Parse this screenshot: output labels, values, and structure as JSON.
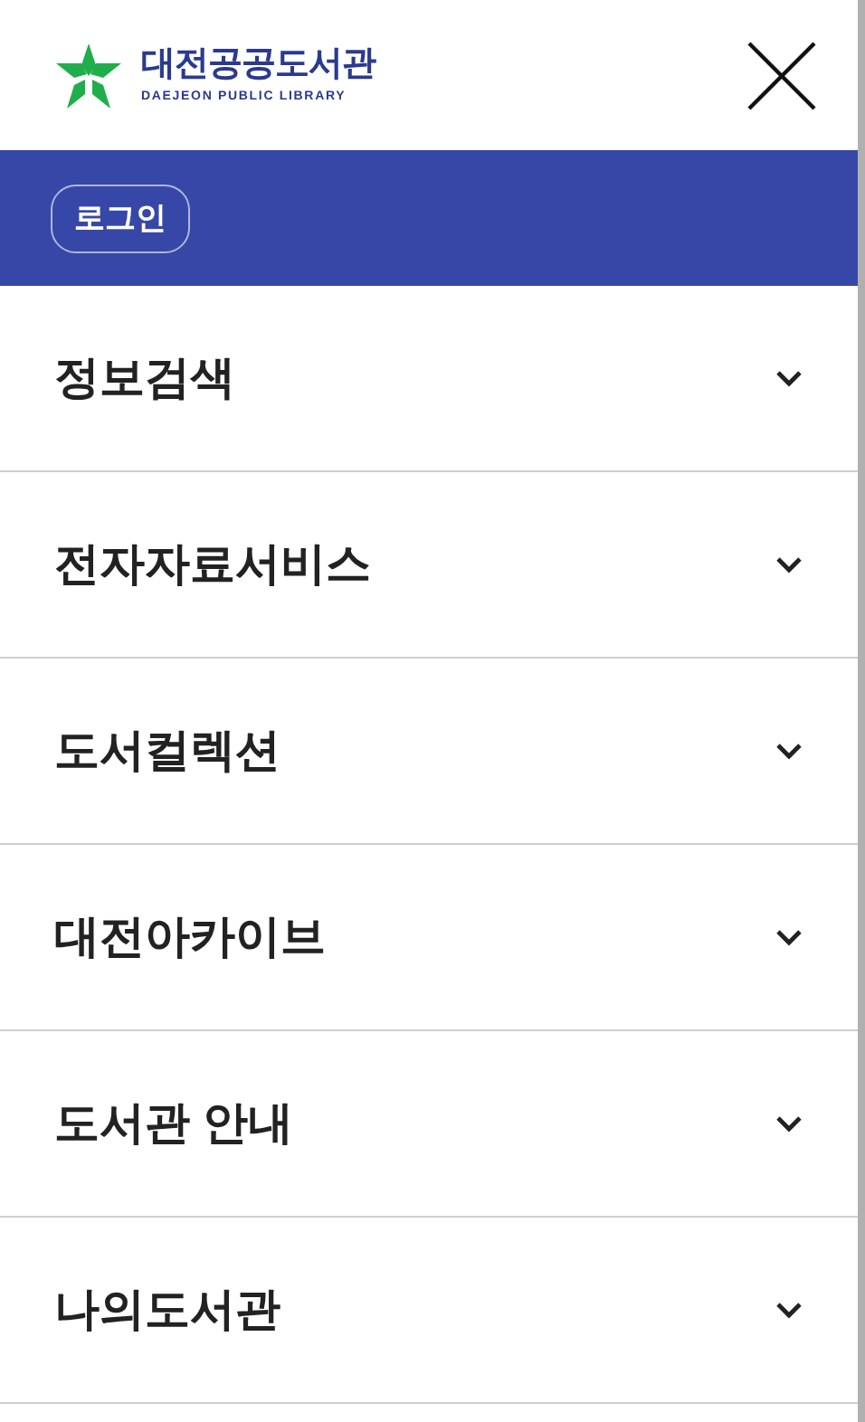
{
  "header": {
    "logo_title": "대전공공도서관",
    "logo_subtitle": "DAEJEON PUBLIC LIBRARY"
  },
  "login_button": "로그인",
  "menu": [
    {
      "label": "정보검색",
      "expanded": false
    },
    {
      "label": "전자자료서비스",
      "expanded": false
    },
    {
      "label": "도서컬렉션",
      "expanded": false
    },
    {
      "label": "대전아카이브",
      "expanded": false
    },
    {
      "label": "도서관 안내",
      "expanded": false
    },
    {
      "label": "나의도서관",
      "expanded": false
    }
  ]
}
